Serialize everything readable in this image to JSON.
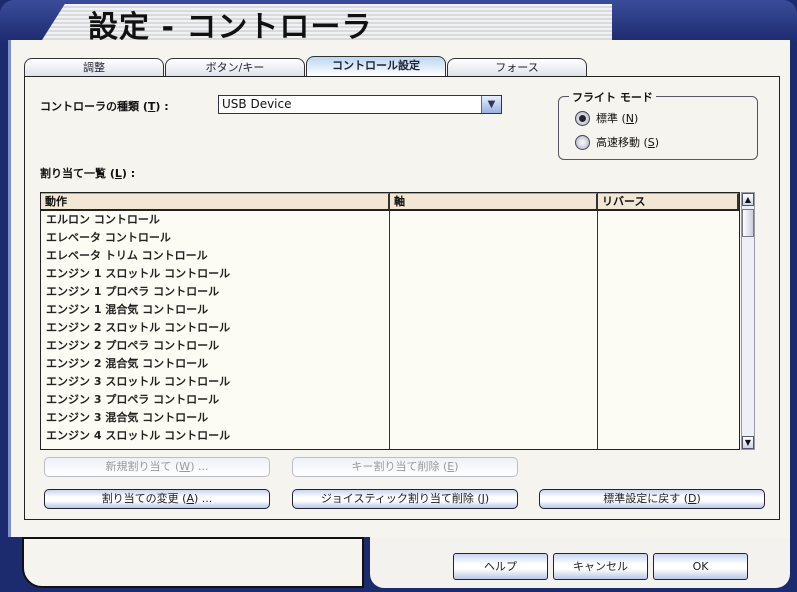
{
  "window": {
    "title": "設定 - コントローラ"
  },
  "tabs": [
    {
      "label": "調整"
    },
    {
      "label": "ボタン/キー"
    },
    {
      "label": "コントロール設定",
      "active": true
    },
    {
      "label": "フォース"
    }
  ],
  "controller": {
    "label": "コントローラの種類",
    "key": "T",
    "value": "USB Device"
  },
  "flight_mode": {
    "title": "フライト モード",
    "options": [
      {
        "label": "標準",
        "key": "N",
        "selected": true
      },
      {
        "label": "高速移動",
        "key": "S",
        "selected": false
      }
    ]
  },
  "assignments": {
    "label": "割り当て一覧",
    "key": "L",
    "columns": [
      "動作",
      "軸",
      "リバース"
    ],
    "rows": [
      "エルロン コントロール",
      "エレベータ コントロール",
      "エレベータ トリム コントロール",
      "エンジン 1 スロットル コントロール",
      "エンジン 1 プロペラ コントロール",
      "エンジン 1 混合気 コントロール",
      "エンジン 2 スロットル コントロール",
      "エンジン 2 プロペラ コントロール",
      "エンジン 2 混合気 コントロール",
      "エンジン 3 スロットル コントロール",
      "エンジン 3 プロペラ コントロール",
      "エンジン 3 混合気 コントロール",
      "エンジン 4 スロットル コントロール"
    ]
  },
  "buttons": {
    "new": {
      "label": "新規割り当て",
      "key": "W",
      "suffix": " ..."
    },
    "delete_key": {
      "label": "キー割り当て削除",
      "key": "E",
      "suffix": ""
    },
    "change": {
      "label": "割り当ての変更",
      "key": "A",
      "suffix": " ..."
    },
    "delete_joy": {
      "label": "ジョイスティック割り当て削除",
      "key": "J",
      "suffix": ""
    },
    "reset": {
      "label": "標準設定に戻す",
      "key": "D",
      "suffix": ""
    },
    "help": "ヘルプ",
    "cancel": "キャンセル",
    "ok": "OK"
  }
}
